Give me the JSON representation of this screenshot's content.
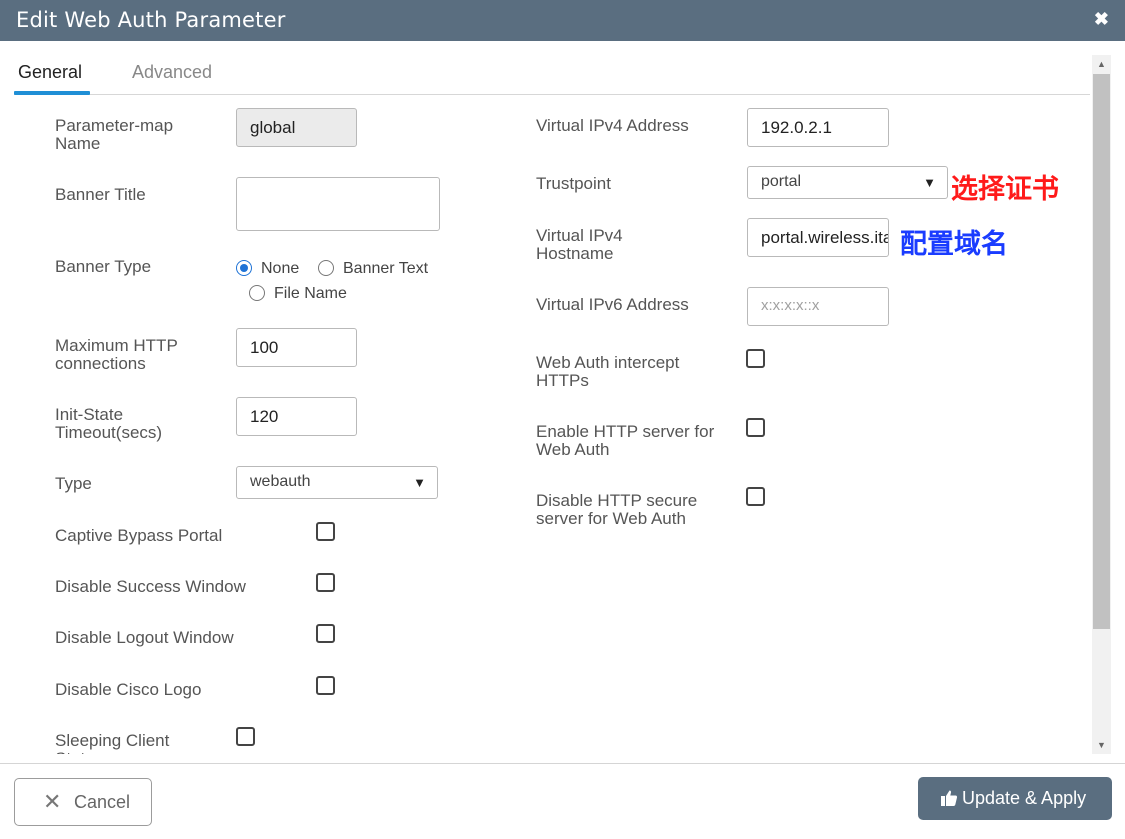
{
  "dialog": {
    "title": "Edit Web Auth Parameter",
    "close_glyph": "✖",
    "close_icon": "close-icon"
  },
  "tabs": [
    {
      "label": "General",
      "active": true
    },
    {
      "label": "Advanced",
      "active": false
    }
  ],
  "left": {
    "param_map_name": {
      "label": "Parameter-map Name",
      "value": "global"
    },
    "banner_title": {
      "label": "Banner Title",
      "value": ""
    },
    "banner_type": {
      "label": "Banner Type",
      "options": [
        "None",
        "Banner Text",
        "File Name"
      ],
      "selected": "None"
    },
    "max_http": {
      "label": "Maximum HTTP connections",
      "value": "100"
    },
    "init_state": {
      "label": "Init-State Timeout(secs)",
      "value": "120"
    },
    "type": {
      "label": "Type",
      "value": "webauth"
    },
    "captive_bypass": {
      "label": "Captive Bypass Portal",
      "checked": false
    },
    "disable_success": {
      "label": "Disable Success Window",
      "checked": false
    },
    "disable_logout": {
      "label": "Disable Logout Window",
      "checked": false
    },
    "disable_cisco_logo": {
      "label": "Disable Cisco Logo",
      "checked": false
    },
    "sleeping_client": {
      "label": "Sleeping Client Status",
      "checked": false
    }
  },
  "right": {
    "virtual_ipv4": {
      "label": "Virtual IPv4 Address",
      "value": "192.0.2.1"
    },
    "trustpoint": {
      "label": "Trustpoint",
      "value": "portal"
    },
    "virtual_ipv4_hostname": {
      "label": "Virtual IPv4 Hostname",
      "value": "portal.wireless.ita"
    },
    "virtual_ipv6": {
      "label": "Virtual IPv6 Address",
      "placeholder": "x:x:x:x::x"
    },
    "intercept_https": {
      "label": "Web Auth intercept HTTPs",
      "checked": false
    },
    "enable_http": {
      "label": "Enable HTTP server for Web Auth",
      "checked": false
    },
    "disable_https": {
      "label": "Disable HTTP secure server for Web Auth",
      "checked": false
    }
  },
  "annotations": {
    "select_cert": "选择证书",
    "config_domain": "配置域名"
  },
  "footer": {
    "cancel_label": "Cancel",
    "apply_label": "Update & Apply"
  },
  "colors": {
    "header_bg": "#5a6e80",
    "tab_accent": "#1f8fd6",
    "radio_accent": "#1f73d6",
    "annotation_red": "#ff1a1a",
    "annotation_blue": "#1a3cff"
  }
}
